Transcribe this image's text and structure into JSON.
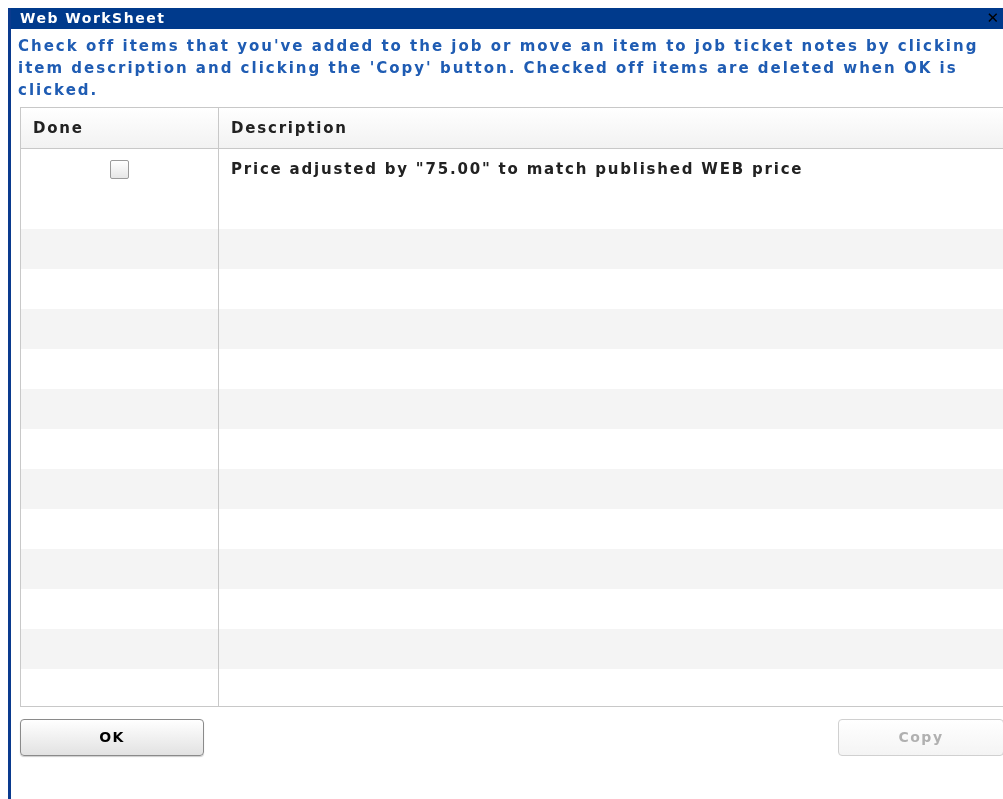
{
  "window": {
    "title": "Web WorkSheet",
    "close": "✕"
  },
  "instructions": "Check off items that you've added to the job or move an item to job ticket notes by clicking item description and clicking the 'Copy' button. Checked off items are deleted when OK is clicked.",
  "table": {
    "columns": [
      "Done",
      "Description"
    ],
    "rows": [
      {
        "checked": false,
        "description": "Price adjusted by \"75.00\" to match published WEB price"
      }
    ]
  },
  "buttons": [
    {
      "label": "OK",
      "disabled": false
    },
    {
      "label": "Copy",
      "disabled": true
    }
  ]
}
